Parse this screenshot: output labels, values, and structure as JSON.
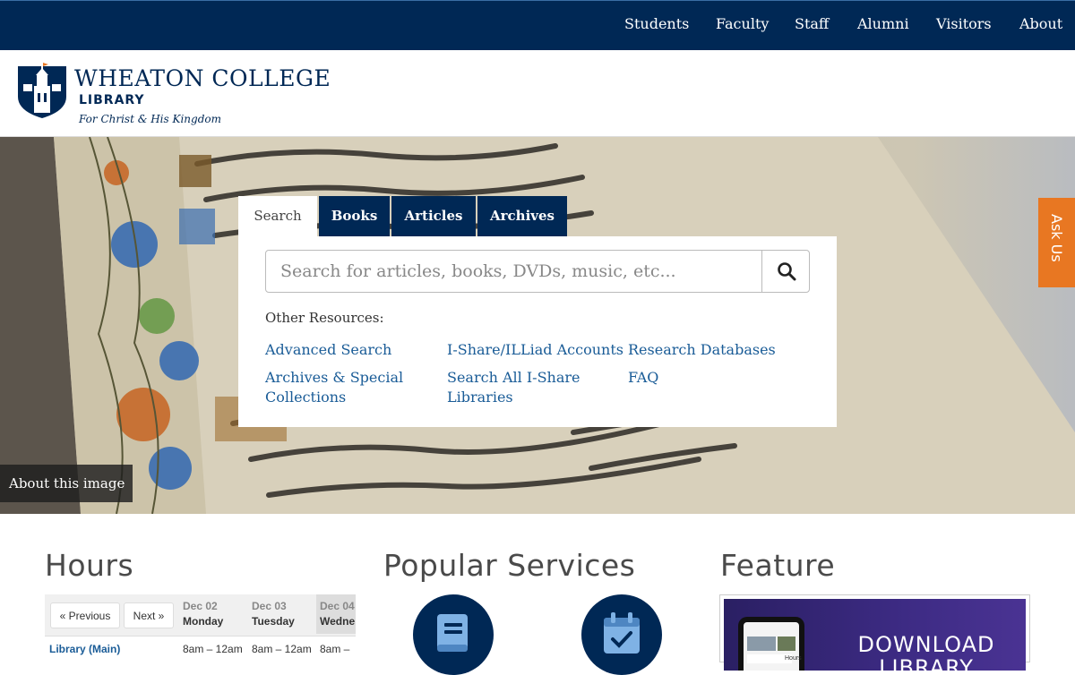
{
  "topnav": {
    "items": [
      "Students",
      "Faculty",
      "Staff",
      "Alumni",
      "Visitors",
      "About"
    ]
  },
  "logo": {
    "title": "WHEATON COLLEGE",
    "subtitle": "LIBRARY",
    "motto": "For Christ & His Kingdom"
  },
  "hero": {
    "about_label": "About this image",
    "ask_label": "Ask Us"
  },
  "search": {
    "tabs": [
      "Search",
      "Books",
      "Articles",
      "Archives"
    ],
    "placeholder": "Search for articles, books, DVDs, music, etc...",
    "other_label": "Other Resources:",
    "links": [
      "Advanced Search",
      "I-Share/ILLiad Accounts",
      "Research Databases",
      "Archives & Special Collections",
      "Search All I-Share Libraries",
      "FAQ"
    ]
  },
  "hours": {
    "title": "Hours",
    "prev": "« Previous",
    "next": "Next »",
    "days": [
      {
        "date": "Dec 02",
        "weekday": "Monday"
      },
      {
        "date": "Dec 03",
        "weekday": "Tuesday"
      },
      {
        "date": "Dec 04",
        "weekday": "Wedne"
      }
    ],
    "row_label": "Library (Main)",
    "row_values": [
      "8am – 12am",
      "8am – 12am",
      "8am –"
    ]
  },
  "services": {
    "title": "Popular Services",
    "icons": [
      "book-icon",
      "calendar-check-icon"
    ]
  },
  "feature": {
    "title": "Feature",
    "banner_line1": "DOWNLOAD",
    "banner_line2": "LIBRARY MOBILE",
    "phone_label": "Hours"
  },
  "colors": {
    "navy": "#002855",
    "orange": "#e87722",
    "link": "#1a5c97"
  }
}
